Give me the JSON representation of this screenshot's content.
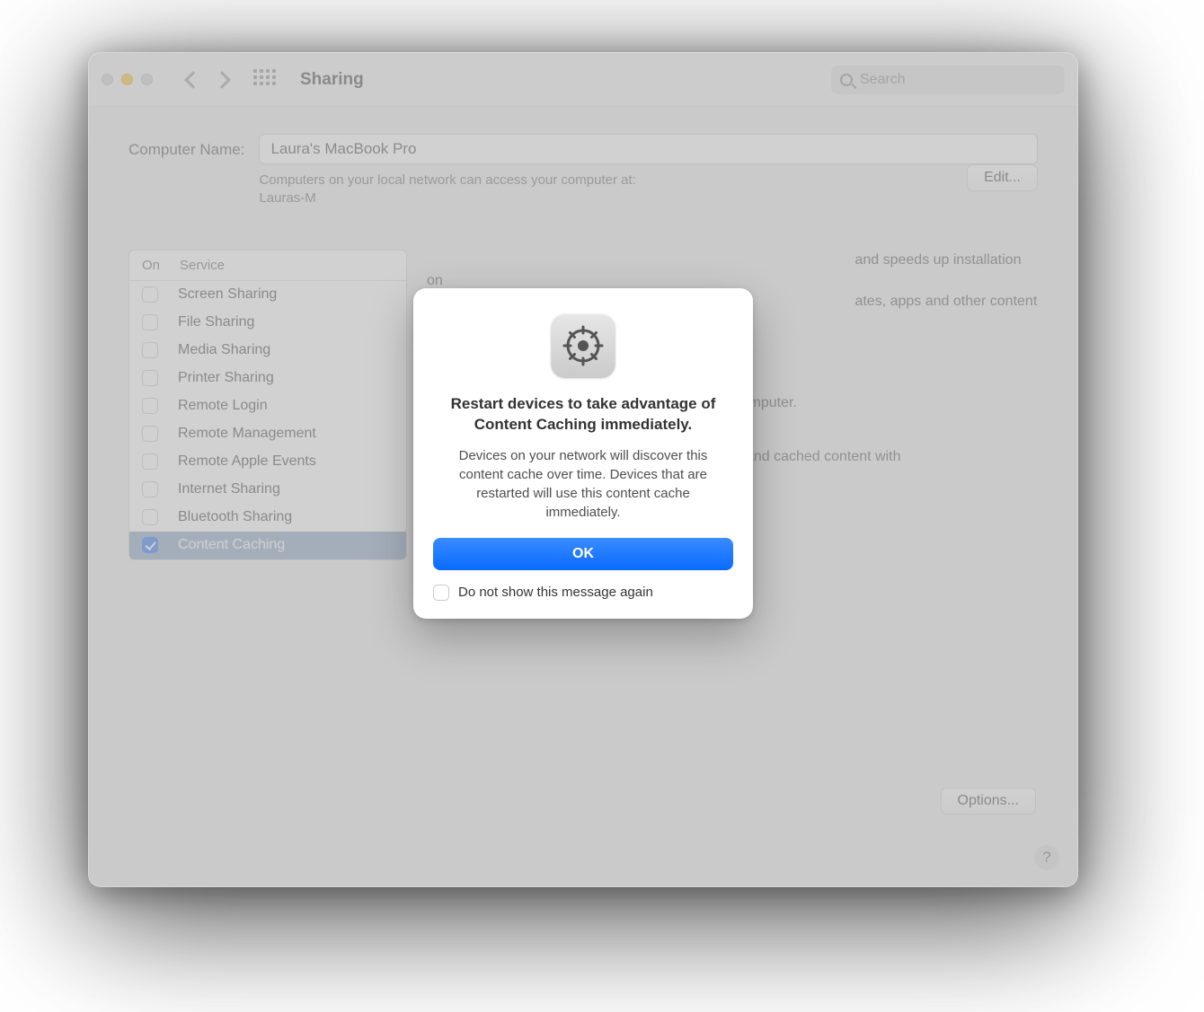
{
  "window": {
    "title": "Sharing"
  },
  "search": {
    "placeholder": "Search"
  },
  "computerName": {
    "label": "Computer Name:",
    "value": "Laura's MacBook Pro",
    "helpLine1": "Computers on your local network can access your computer at:",
    "helpLine2": "Lauras-M",
    "editLabel": "Edit..."
  },
  "serviceHeader": {
    "on": "On",
    "service": "Service"
  },
  "services": [
    {
      "label": "Screen Sharing",
      "checked": false
    },
    {
      "label": "File Sharing",
      "checked": false
    },
    {
      "label": "Media Sharing",
      "checked": false
    },
    {
      "label": "Printer Sharing",
      "checked": false
    },
    {
      "label": "Remote Login",
      "checked": false
    },
    {
      "label": "Remote Management",
      "checked": false
    },
    {
      "label": "Remote Apple Events",
      "checked": false
    },
    {
      "label": "Internet Sharing",
      "checked": false
    },
    {
      "label": "Bluetooth Sharing",
      "checked": false
    },
    {
      "label": "Content Caching",
      "checked": true,
      "selected": true
    }
  ],
  "detail": {
    "descFrag1": "and speeds up installation on",
    "descFrag2": "ates, apps and other content on",
    "line1": "on this computer.",
    "line2a": "nnection and cached content with",
    "line2b": "."
  },
  "optionsLabel": "Options...",
  "modal": {
    "title": "Restart devices to take advantage of Content Caching immediately.",
    "body": "Devices on your network will discover this content cache over time. Devices that are restarted will use this content cache immediately.",
    "ok": "OK",
    "dontShow": "Do not show this message again"
  }
}
